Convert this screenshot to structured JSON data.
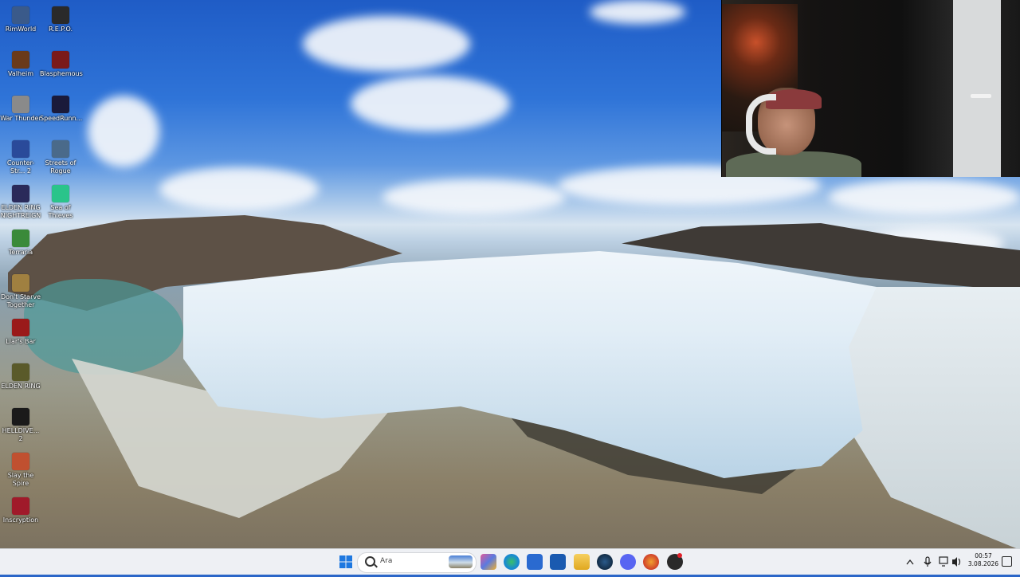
{
  "desktop": {
    "icons": [
      {
        "label": "RimWorld",
        "color": "#3a5a8a"
      },
      {
        "label": "R.E.P.O.",
        "color": "#2a2a2a"
      },
      {
        "label": "Valheim",
        "color": "#6a3a1a"
      },
      {
        "label": "Blasphemous",
        "color": "#7a1a1a"
      },
      {
        "label": "War Thunder",
        "color": "#8a8a8a"
      },
      {
        "label": "SpeedRunn...",
        "color": "#1a1a3a"
      },
      {
        "label": "Counter-Str... 2",
        "color": "#2a4a9a"
      },
      {
        "label": "Streets of Rogue",
        "color": "#4a6a8a"
      },
      {
        "label": "ELDEN RING NIGHTREIGN",
        "color": "#2a2a5a"
      },
      {
        "label": "Sea of Thieves",
        "color": "#2ac48a"
      },
      {
        "label": "Terraria",
        "color": "#3a8a3a"
      },
      {
        "label": "Don't Starve Together",
        "color": "#a08040"
      },
      {
        "label": "Liar's Bar",
        "color": "#9a1a1a"
      },
      {
        "label": "ELDEN RING",
        "color": "#5a5a2a"
      },
      {
        "label": "HELLDIVE... 2",
        "color": "#1a1a1a"
      },
      {
        "label": "Slay the Spire",
        "color": "#c05030"
      },
      {
        "label": "Inscryption",
        "color": "#a01a2a"
      }
    ]
  },
  "taskbar": {
    "search_placeholder": "Ara",
    "apps": [
      {
        "name": "start-button",
        "color": "#1e78e0"
      },
      {
        "name": "widgets",
        "color": "#e05a9a"
      },
      {
        "name": "edge",
        "color": "#1a8ad0"
      },
      {
        "name": "store",
        "color": "#2a6ad0"
      },
      {
        "name": "outlook",
        "color": "#1a5ab0"
      },
      {
        "name": "file-explorer",
        "color": "#f0c030"
      },
      {
        "name": "steam",
        "color": "#1a3a5a"
      },
      {
        "name": "discord",
        "color": "#5865f2"
      },
      {
        "name": "firefox",
        "color": "#e0602a"
      },
      {
        "name": "recorder",
        "color": "#3a3a3a"
      }
    ],
    "time": "00:57",
    "date": "3.08.2026"
  }
}
